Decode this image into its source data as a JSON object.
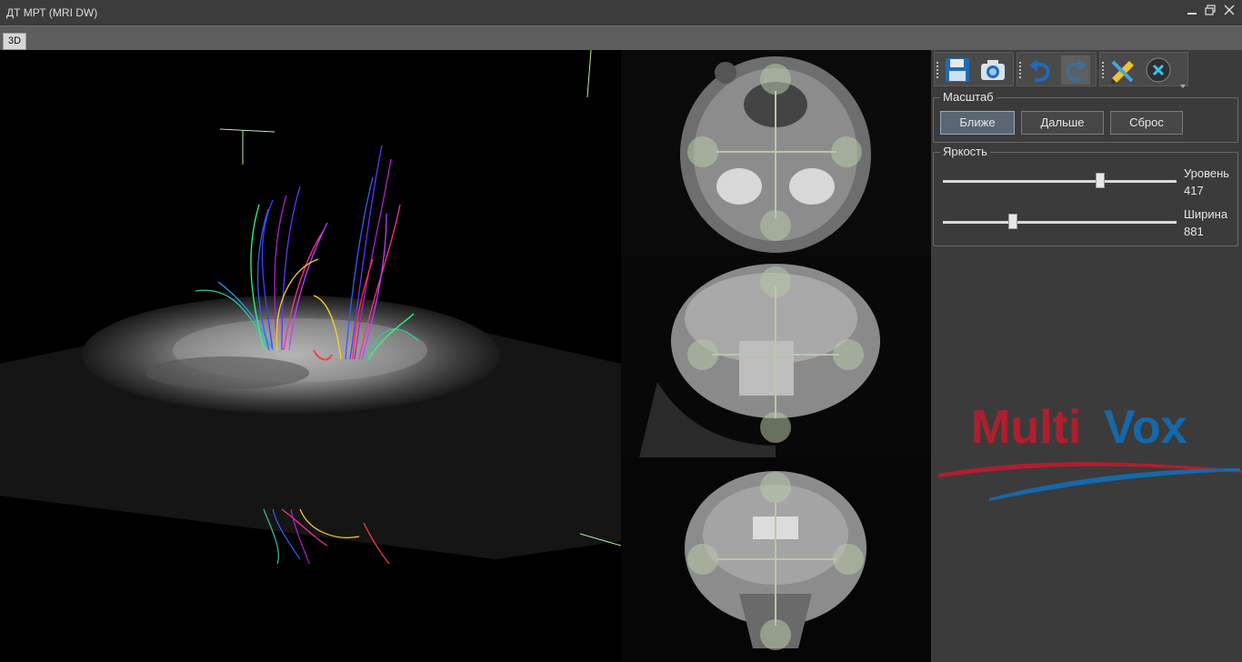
{
  "window": {
    "title": "ДТ МРТ (MRI DW)",
    "minimize_icon": "minimize-icon",
    "restore_icon": "restore-icon",
    "close_icon": "close-icon"
  },
  "tabs": [
    {
      "label": "3D",
      "active": true
    }
  ],
  "toolbar": {
    "buttons": [
      {
        "name": "save",
        "icon": "floppy-disk-icon"
      },
      {
        "name": "screenshot",
        "icon": "camera-icon"
      },
      {
        "name": "undo",
        "icon": "undo-arrow-icon"
      },
      {
        "name": "redo",
        "icon": "redo-arrow-icon",
        "enabled": false
      },
      {
        "name": "measure-tools",
        "icon": "pencil-ruler-icon"
      },
      {
        "name": "clear",
        "icon": "close-circle-icon"
      }
    ]
  },
  "scale": {
    "title": "Масштаб",
    "closer_label": "Ближе",
    "farther_label": "Дальше",
    "reset_label": "Сброс"
  },
  "brightness": {
    "title": "Яркость",
    "level": {
      "label": "Уровень",
      "value": "417",
      "position_fraction": 0.68
    },
    "width": {
      "label": "Ширина",
      "value": "881",
      "position_fraction": 0.29
    }
  },
  "logo": {
    "text_part1": "Multi",
    "text_part2": "Vox"
  },
  "colors": {
    "accent_blue": "#1e6bb8",
    "logo_red": "#b01e2e",
    "logo_blue": "#1668a8",
    "crosshair": "#b8c8a8"
  }
}
